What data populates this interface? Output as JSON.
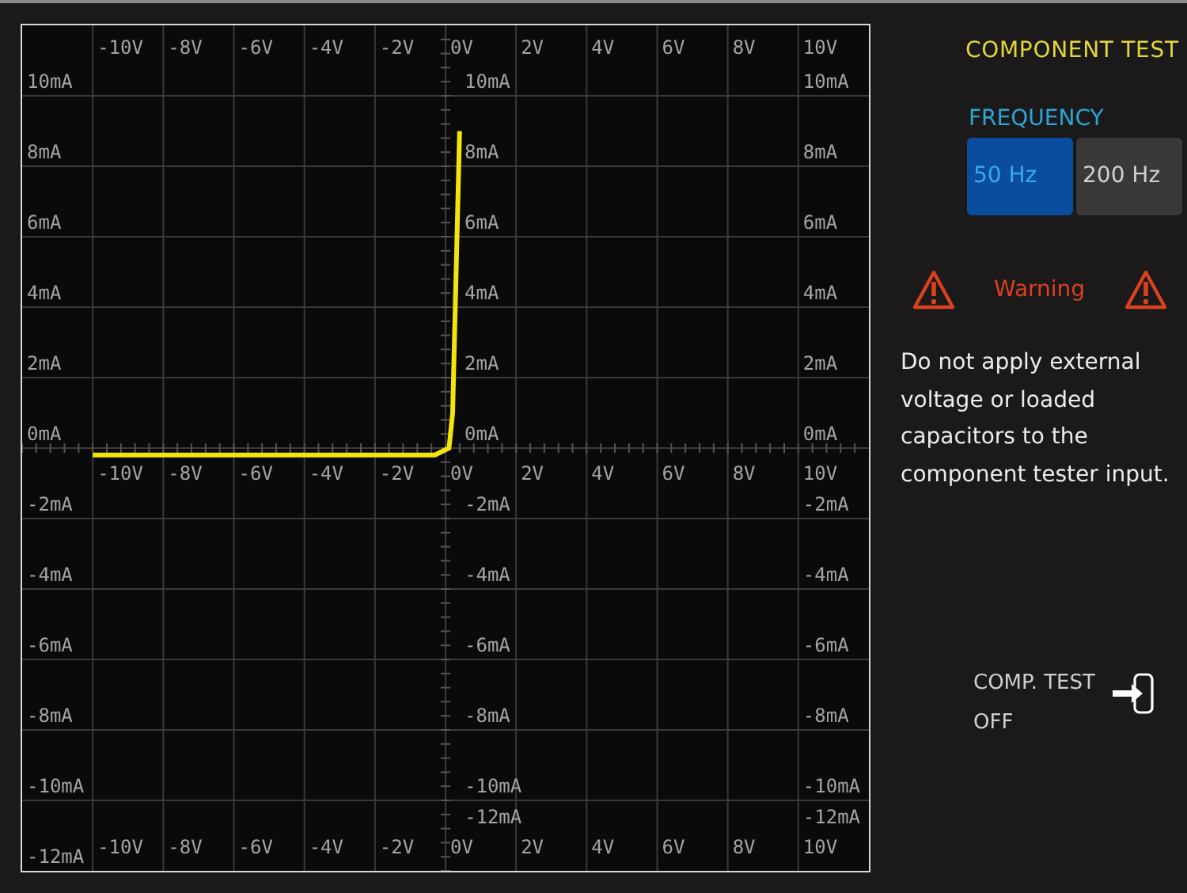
{
  "plot": {
    "x_labels_top": [
      "-10V",
      "-8V",
      "-6V",
      "-4V",
      "-2V",
      "0V",
      "2V",
      "4V",
      "6V",
      "8V",
      "10V"
    ],
    "x_labels_middle": [
      "-10V",
      "-8V",
      "-6V",
      "-4V",
      "-2V",
      "0V",
      "2V",
      "4V",
      "6V",
      "8V",
      "10V"
    ],
    "x_labels_bottom": [
      "-10V",
      "-8V",
      "-6V",
      "-4V",
      "-2V",
      "0V",
      "2V",
      "4V",
      "6V",
      "8V",
      "10V"
    ],
    "y_labels_left": [
      "10mA",
      "8mA",
      "6mA",
      "4mA",
      "2mA",
      "0mA",
      "-2mA",
      "-4mA",
      "-6mA",
      "-8mA",
      "-10mA",
      "-12mA"
    ],
    "y_labels_center": [
      "10mA",
      "8mA",
      "6mA",
      "4mA",
      "2mA",
      "0mA",
      "-2mA",
      "-4mA",
      "-6mA",
      "-8mA",
      "-10mA",
      "-12mA"
    ],
    "y_labels_right": [
      "10mA",
      "8mA",
      "6mA",
      "4mA",
      "2mA",
      "0mA",
      "-2mA",
      "-4mA",
      "-6mA",
      "-8mA",
      "-10mA",
      "-12mA"
    ]
  },
  "panel": {
    "title": "COMPONENT TEST",
    "frequency": {
      "label": "FREQUENCY",
      "options": [
        {
          "label": "50 Hz",
          "selected": true
        },
        {
          "label": "200 Hz",
          "selected": false
        }
      ]
    },
    "warning": {
      "title": "Warning",
      "message": "Do not apply external voltage or loaded capacitors to the component tester input."
    },
    "soft_key": {
      "line1": "COMP. TEST",
      "line2": "OFF"
    }
  }
}
